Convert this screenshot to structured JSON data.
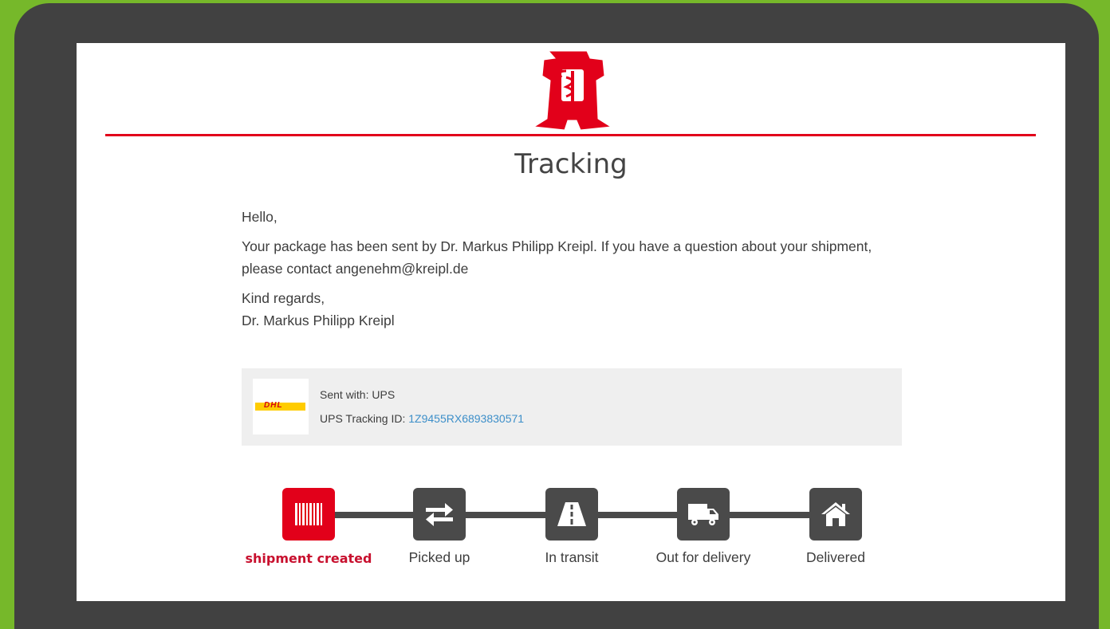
{
  "page": {
    "title": "Tracking"
  },
  "message": {
    "greeting": "Hello,",
    "body": "Your package has been sent by Dr. Markus Philipp Kreipl. If you have a question about your shipment, please contact angenehm@kreipl.de",
    "closing": "Kind regards,",
    "signature": "Dr. Markus Philipp Kreipl"
  },
  "shipment": {
    "carrier_logo": "DHL",
    "sent_with_label": "Sent with: UPS",
    "tracking_label": "UPS Tracking ID: ",
    "tracking_id": "1Z9455RX6893830571"
  },
  "steps": [
    {
      "label": "shipment created",
      "icon": "barcode-icon",
      "active": true
    },
    {
      "label": "Picked up",
      "icon": "transfer-arrows-icon",
      "active": false
    },
    {
      "label": "In transit",
      "icon": "road-icon",
      "active": false
    },
    {
      "label": "Out for delivery",
      "icon": "truck-icon",
      "active": false
    },
    {
      "label": "Delivered",
      "icon": "home-icon",
      "active": false
    }
  ],
  "colors": {
    "background": "#76b82a",
    "frame": "#414141",
    "accent": "#e2001a",
    "step_inactive": "#4a4a4a",
    "link": "#3d8fc9"
  }
}
